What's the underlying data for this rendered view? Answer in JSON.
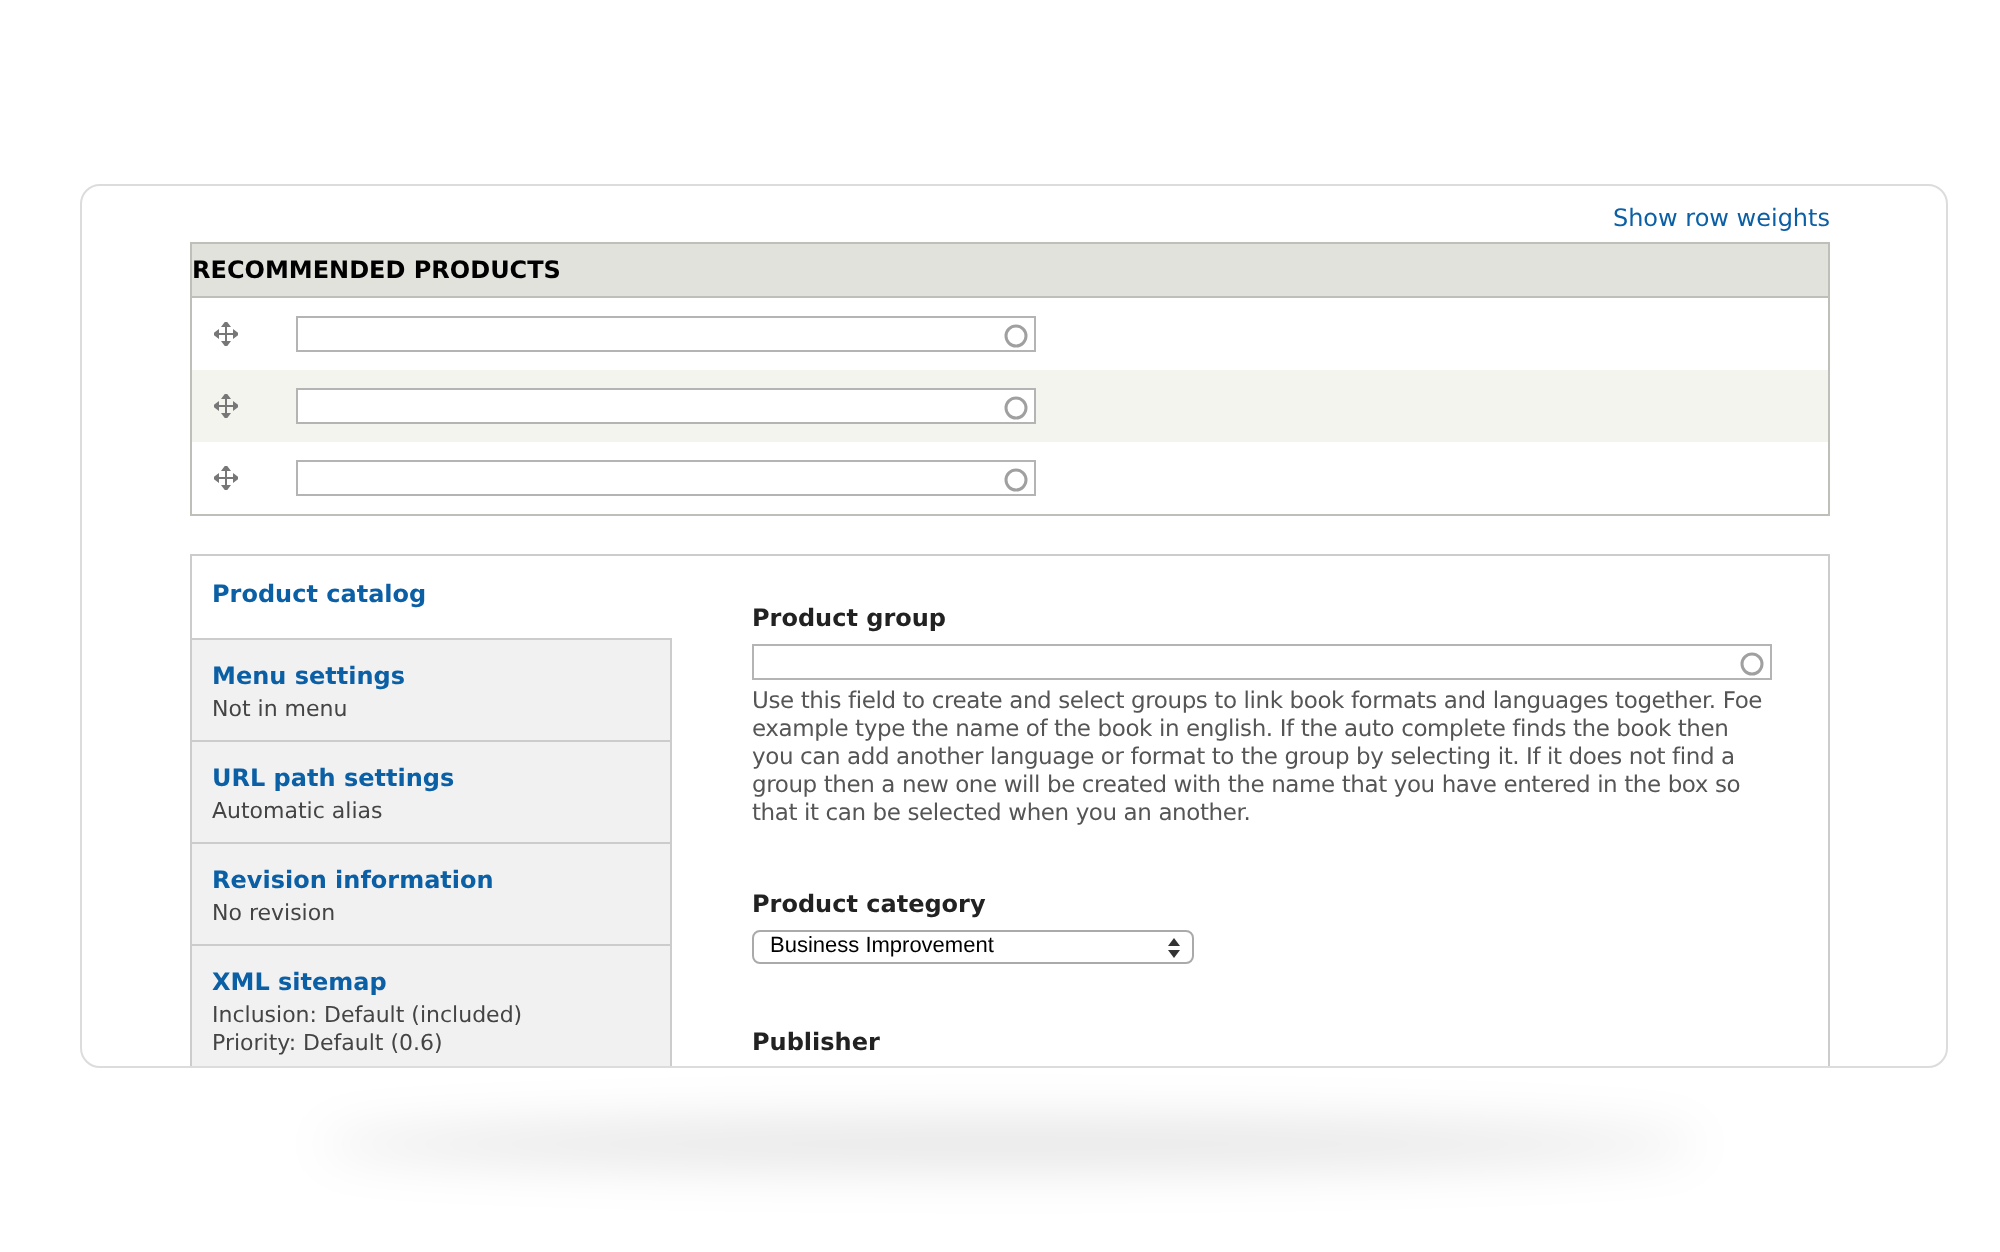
{
  "show_row_weights": "Show row weights",
  "recommended_products": {
    "title": "RECOMMENDED PRODUCTS",
    "rows": [
      {
        "draggable": true,
        "autocomplete": true
      },
      {
        "draggable": true,
        "autocomplete": true
      },
      {
        "draggable": true,
        "autocomplete": true
      }
    ]
  },
  "vertical_tabs": [
    {
      "title": "Product catalog",
      "selected": true
    },
    {
      "title": "Menu settings",
      "summary": [
        "Not in menu"
      ],
      "selected": false
    },
    {
      "title": "URL path settings",
      "summary": [
        "Automatic alias"
      ],
      "selected": false
    },
    {
      "title": "Revision information",
      "summary": [
        "No revision"
      ],
      "selected": false
    },
    {
      "title": "XML sitemap",
      "summary": [
        "Inclusion: Default (included)",
        "Priority: Default (0.6)"
      ],
      "selected": false
    }
  ],
  "fields": [
    {
      "kind": "autocomplete",
      "label": "Product group",
      "description": "Use this field to create and select groups to link book formats and languages together. Foe example type the name of the book in english. If the auto complete finds the book then you can add another language or format to the group by selecting it. If it does not find a group then a new one will be created with the name that you have entered in the box so that it can be selected when you an another."
    },
    {
      "kind": "select",
      "label": "Product category",
      "value": "Business Improvement"
    },
    {
      "kind": "label_only",
      "label": "Publisher"
    }
  ]
}
